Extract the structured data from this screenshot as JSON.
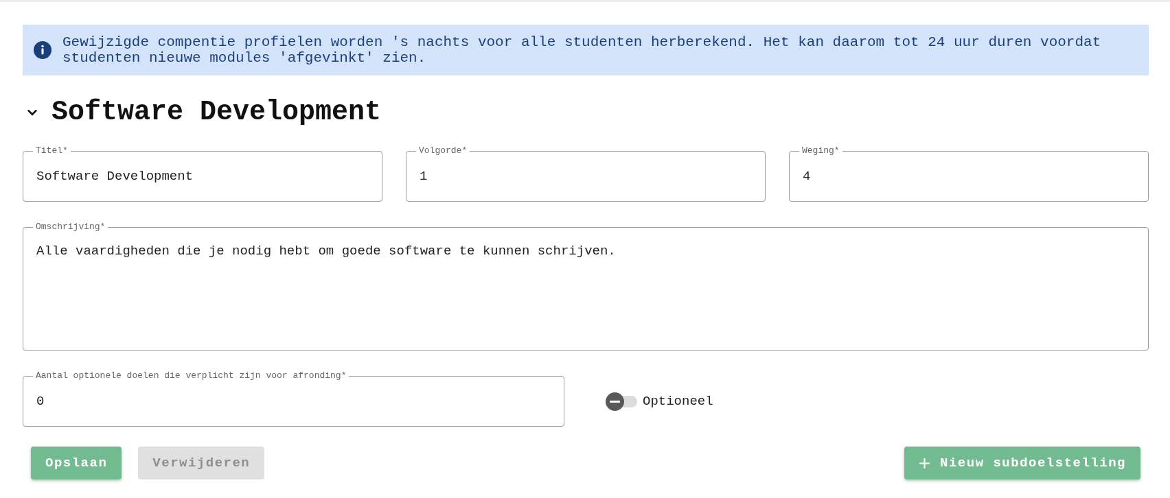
{
  "notice": {
    "text": "Gewijzigde compentie profielen worden 's nachts voor alle studenten herberekend. Het kan daarom tot 24 uur duren voordat studenten nieuwe modules 'afgevinkt' zien."
  },
  "section": {
    "title": "Software Development",
    "expanded": true
  },
  "fields": [
    {
      "kind": "input",
      "label": "Titel*",
      "value": "Software Development"
    },
    {
      "kind": "input",
      "label": "Volgorde*",
      "value": "1"
    },
    {
      "kind": "input",
      "label": "Weging*",
      "value": "4"
    },
    {
      "kind": "textarea",
      "label": "Omschrijving*",
      "value": "Alle vaardigheden die je nodig hebt om goede software te kunnen schrijven."
    },
    {
      "kind": "input",
      "label": "Aantal optionele doelen die verplicht zijn voor afronding*",
      "value": "0"
    }
  ],
  "optional_toggle": {
    "label": "Optioneel",
    "on": false
  },
  "buttons": [
    {
      "kind": "save",
      "label": "Opslaan",
      "disabled": false
    },
    {
      "kind": "delete",
      "label": "Verwijderen",
      "disabled": true
    },
    {
      "kind": "add",
      "label": "Nieuw subdoelstelling",
      "disabled": false
    }
  ]
}
